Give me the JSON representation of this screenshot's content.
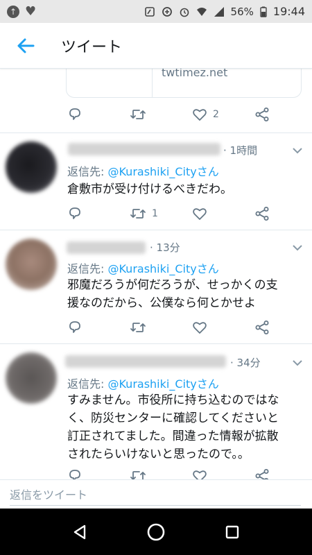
{
  "status_bar": {
    "battery_percent": "56%",
    "time": "19:44"
  },
  "app_bar": {
    "title": "ツイート"
  },
  "top_card": {
    "domain": "twtimez.net"
  },
  "top_actions": {
    "like_count": "2"
  },
  "tweets": [
    {
      "time": "· 1時間",
      "reply_prefix": "返信先: ",
      "reply_handle": "@Kurashiki_City",
      "reply_suffix": "さん",
      "text": "倉敷市が受け付けるべきだわ。",
      "retweet_count": "1"
    },
    {
      "time": "· 13分",
      "reply_prefix": "返信先: ",
      "reply_handle": "@Kurashiki_City",
      "reply_suffix": "さん",
      "text_lines": [
        "邪魔だろうが何だろうが、せっかくの支",
        "援なのだから、公僕なら何とかせよ"
      ]
    },
    {
      "time": "· 34分",
      "reply_prefix": "返信先: ",
      "reply_handle": "@Kurashiki_City",
      "reply_suffix": "さん",
      "text_lines": [
        "すみません。市役所に持ち込むのではな",
        "く、防災センターに確認してくださいと",
        "訂正されてました。間違った情報が拡散",
        "されたらいけないと思ったので。。"
      ]
    }
  ],
  "reply_bar": {
    "placeholder": "返信をツイート"
  },
  "colors": {
    "accent": "#1da1f2",
    "secondary_text": "#657786",
    "divider": "#e1e8ed"
  }
}
